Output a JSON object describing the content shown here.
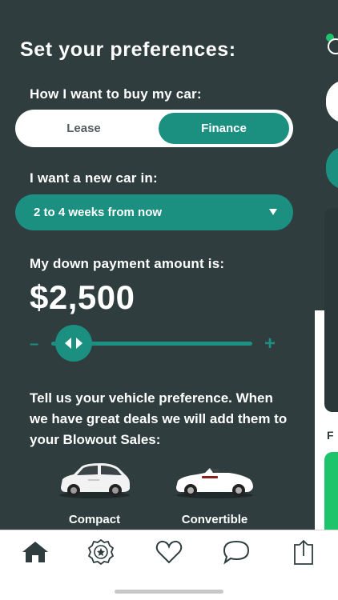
{
  "title": "Set your preferences:",
  "buy": {
    "label": "How I want to buy my car:",
    "options": [
      "Lease",
      "Finance"
    ],
    "selected": "Finance"
  },
  "timing": {
    "label": "I want a new car in:",
    "value": "2 to 4 weeks from now"
  },
  "down_payment": {
    "label": "My down payment amount is:",
    "amount": "$2,500",
    "minus": "–",
    "plus": "+",
    "level": 0.11
  },
  "vehicle_pref": {
    "text": "Tell us your vehicle preference. When we have great deals we will add them to your Blowout Sales:",
    "types": [
      {
        "label": "Compact",
        "color": "#f2f2f2"
      },
      {
        "label": "Convertible",
        "color": "#ffffff"
      }
    ]
  },
  "background_app": {
    "letter": "F"
  },
  "tabs": [
    {
      "icon": "home-icon"
    },
    {
      "icon": "badge-icon"
    },
    {
      "icon": "heart-icon"
    },
    {
      "icon": "chat-bubble-icon"
    },
    {
      "icon": "share-icon"
    }
  ],
  "colors": {
    "panel": "#2f3d3e",
    "accent": "#1b8f80",
    "green": "#1ec46b"
  }
}
